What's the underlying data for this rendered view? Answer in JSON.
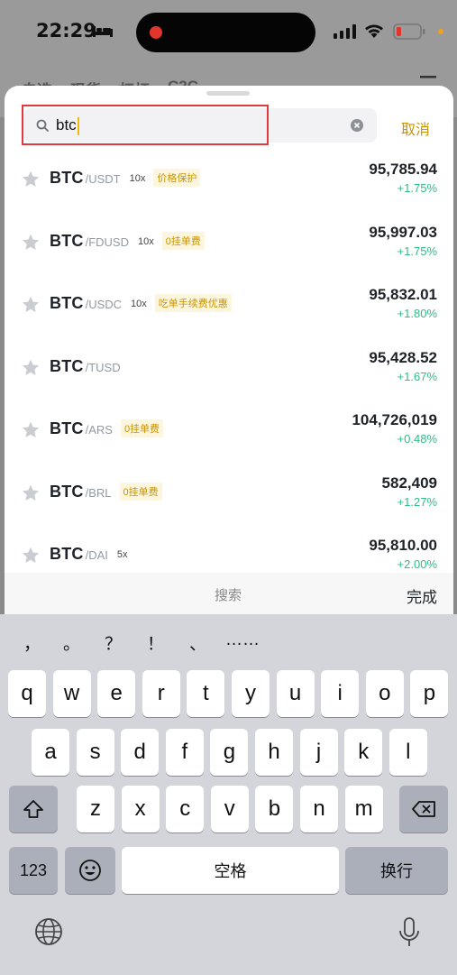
{
  "status": {
    "time": "22:29"
  },
  "background_tabs": [
    "自选",
    "现货",
    "杠杆",
    "C2C"
  ],
  "search": {
    "value": "btc",
    "cancel_label": "取消"
  },
  "results": [
    {
      "base": "BTC",
      "quote": "/USDT",
      "leverage": "10x",
      "tag": "价格保护",
      "price": "95,785.94",
      "change": "+1.75%"
    },
    {
      "base": "BTC",
      "quote": "/FDUSD",
      "leverage": "10x",
      "tag": "0挂单费",
      "price": "95,997.03",
      "change": "+1.75%"
    },
    {
      "base": "BTC",
      "quote": "/USDC",
      "leverage": "10x",
      "tag": "吃单手续费优惠",
      "price": "95,832.01",
      "change": "+1.80%"
    },
    {
      "base": "BTC",
      "quote": "/TUSD",
      "leverage": "",
      "tag": "",
      "price": "95,428.52",
      "change": "+1.67%"
    },
    {
      "base": "BTC",
      "quote": "/ARS",
      "leverage": "",
      "tag": "0挂单费",
      "price": "104,726,019",
      "change": "+0.48%"
    },
    {
      "base": "BTC",
      "quote": "/BRL",
      "leverage": "",
      "tag": "0挂单费",
      "price": "582,409",
      "change": "+1.27%"
    },
    {
      "base": "BTC",
      "quote": "/DAI",
      "leverage": "5x",
      "tag": "",
      "price": "95,810.00",
      "change": "+2.00%"
    }
  ],
  "keyboard_accessory": {
    "search_label": "搜索",
    "done_label": "完成"
  },
  "keyboard": {
    "candidates": [
      "，",
      "。",
      "？",
      "！",
      "、",
      "……"
    ],
    "row1": [
      "q",
      "w",
      "e",
      "r",
      "t",
      "y",
      "u",
      "i",
      "o",
      "p"
    ],
    "row2": [
      "a",
      "s",
      "d",
      "f",
      "g",
      "h",
      "j",
      "k",
      "l"
    ],
    "row3": [
      "z",
      "x",
      "c",
      "v",
      "b",
      "n",
      "m"
    ],
    "numbers_label": "123",
    "space_label": "空格",
    "return_label": "换行"
  },
  "colors": {
    "accent": "#c99400",
    "positive": "#2ebd85",
    "highlight_border": "#e0393e"
  }
}
